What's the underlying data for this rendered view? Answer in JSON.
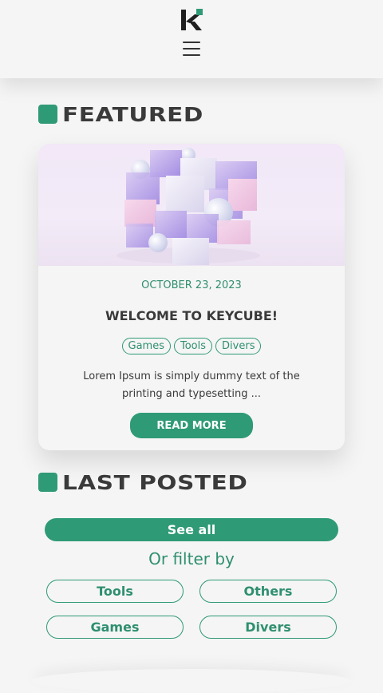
{
  "header": {
    "logo_icon": "keycube-logo-icon",
    "menu_icon": "hamburger-menu-icon"
  },
  "featured": {
    "heading": "FEATURED",
    "post": {
      "image_icon": "glass-cube-image",
      "date": "OCTOBER 23, 2023",
      "title": "WELCOME TO KEYCUBE!",
      "tags": [
        "Games",
        "Tools",
        "Divers"
      ],
      "excerpt": "Lorem Ipsum is simply dummy text of the printing and typesetting ...",
      "read_more_label": "READ MORE"
    }
  },
  "last_posted": {
    "heading": "LAST POSTED",
    "see_all_label": "See all",
    "filter_label": "Or filter by",
    "filters": [
      "Tools",
      "Others",
      "Games",
      "Divers"
    ]
  },
  "colors": {
    "accent": "#2f9a76",
    "text": "#3a3a3a",
    "background": "#f5f5f5"
  }
}
